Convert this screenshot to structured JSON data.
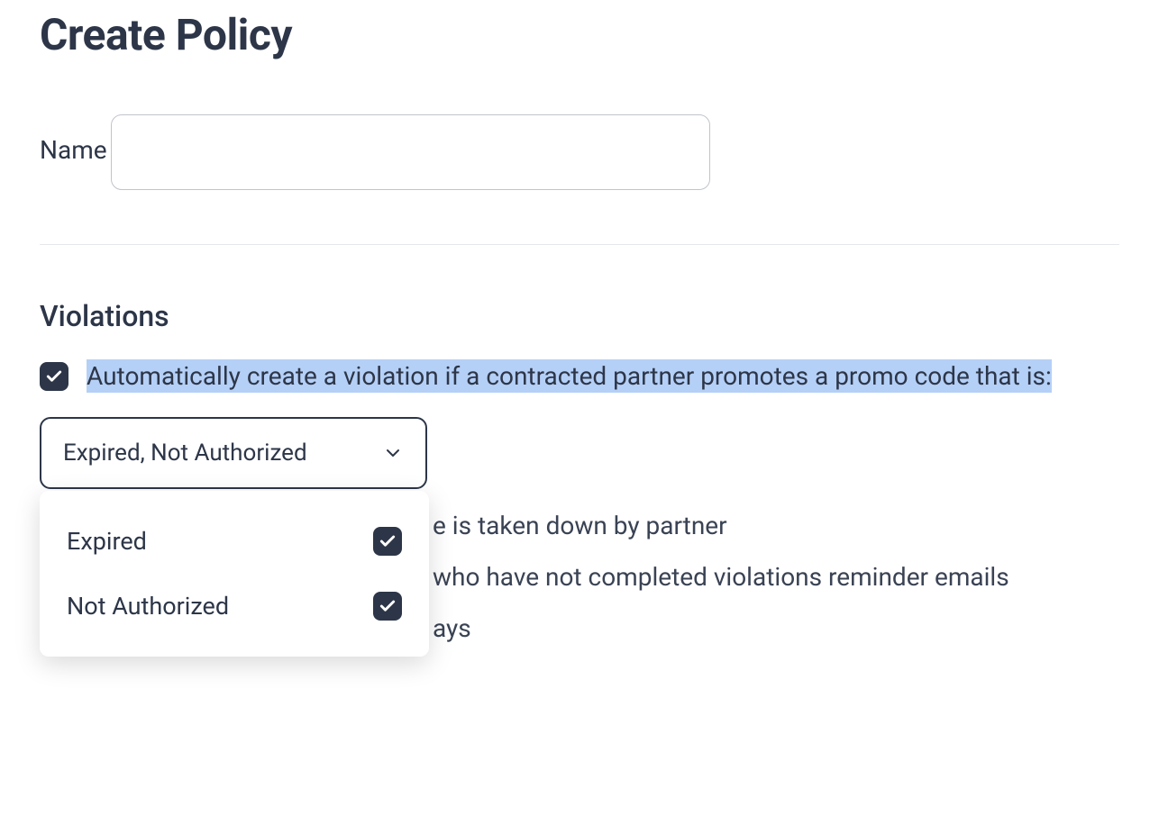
{
  "page": {
    "title": "Create Policy"
  },
  "form": {
    "name_label": "Name",
    "name_value": ""
  },
  "violations": {
    "header": "Violations",
    "auto_create_label": "Automatically create a violation if a contracted partner promotes a promo code that is:",
    "auto_create_checked": true,
    "select_value": "Expired, Not Authorized",
    "options": [
      {
        "label": "Expired",
        "checked": true
      },
      {
        "label": "Not Authorized",
        "checked": true
      }
    ],
    "behind_text_1": "e is taken down by partner",
    "behind_text_2": "who have not completed violations reminder emails",
    "behind_text_3": "ays"
  }
}
